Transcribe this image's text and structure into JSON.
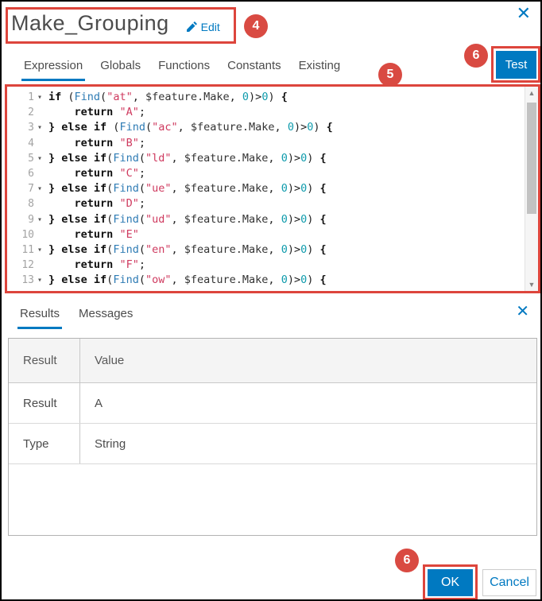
{
  "colors": {
    "accent_blue": "#0079c1",
    "annotation_red": "#dd453c",
    "badge_red": "#d94a42"
  },
  "icons": {
    "close": "✕",
    "scroll_up": "▲",
    "scroll_down": "▼",
    "fold": "▾"
  },
  "header": {
    "title": "Make_Grouping",
    "edit_label": "Edit"
  },
  "annotations": {
    "badge_title": "4",
    "badge_tabs": "5",
    "badge_test": "6",
    "badge_ok": "6"
  },
  "tabs": {
    "items": [
      "Expression",
      "Globals",
      "Functions",
      "Constants",
      "Existing"
    ],
    "active": "Expression"
  },
  "toolbar": {
    "test_label": "Test"
  },
  "editor": {
    "lines": [
      {
        "n": "1",
        "fold": true,
        "t": [
          [
            "kw",
            "if "
          ],
          [
            "pl",
            "("
          ],
          [
            "fn",
            "Find"
          ],
          [
            "pl",
            "("
          ],
          [
            "str",
            "\"at\""
          ],
          [
            "pl",
            ", "
          ],
          [
            "var",
            "$feature.Make"
          ],
          [
            "pl",
            ", "
          ],
          [
            "num",
            "0"
          ],
          [
            "pl",
            ")>"
          ],
          [
            "num",
            "0"
          ],
          [
            "pl",
            ") "
          ],
          [
            "br",
            "{"
          ]
        ]
      },
      {
        "n": "2",
        "fold": false,
        "t": [
          [
            "pl",
            "    "
          ],
          [
            "kw",
            "return"
          ],
          [
            "pl",
            " "
          ],
          [
            "str",
            "\"A\""
          ],
          [
            "pl",
            ";"
          ]
        ]
      },
      {
        "n": "3",
        "fold": true,
        "t": [
          [
            "br",
            "} "
          ],
          [
            "kw",
            "else if"
          ],
          [
            "pl",
            " ("
          ],
          [
            "fn",
            "Find"
          ],
          [
            "pl",
            "("
          ],
          [
            "str",
            "\"ac\""
          ],
          [
            "pl",
            ", "
          ],
          [
            "var",
            "$feature.Make"
          ],
          [
            "pl",
            ", "
          ],
          [
            "num",
            "0"
          ],
          [
            "pl",
            ")>"
          ],
          [
            "num",
            "0"
          ],
          [
            "pl",
            ") "
          ],
          [
            "br",
            "{"
          ]
        ]
      },
      {
        "n": "4",
        "fold": false,
        "t": [
          [
            "pl",
            "    "
          ],
          [
            "kw",
            "return"
          ],
          [
            "pl",
            " "
          ],
          [
            "str",
            "\"B\""
          ],
          [
            "pl",
            ";"
          ]
        ]
      },
      {
        "n": "5",
        "fold": true,
        "t": [
          [
            "br",
            "} "
          ],
          [
            "kw",
            "else if"
          ],
          [
            "pl",
            "("
          ],
          [
            "fn",
            "Find"
          ],
          [
            "pl",
            "("
          ],
          [
            "str",
            "\"ld\""
          ],
          [
            "pl",
            ", "
          ],
          [
            "var",
            "$feature.Make"
          ],
          [
            "pl",
            ", "
          ],
          [
            "num",
            "0"
          ],
          [
            "pl",
            ")>"
          ],
          [
            "num",
            "0"
          ],
          [
            "pl",
            ") "
          ],
          [
            "br",
            "{"
          ]
        ]
      },
      {
        "n": "6",
        "fold": false,
        "t": [
          [
            "pl",
            "    "
          ],
          [
            "kw",
            "return"
          ],
          [
            "pl",
            " "
          ],
          [
            "str",
            "\"C\""
          ],
          [
            "pl",
            ";"
          ]
        ]
      },
      {
        "n": "7",
        "fold": true,
        "t": [
          [
            "br",
            "} "
          ],
          [
            "kw",
            "else if"
          ],
          [
            "pl",
            "("
          ],
          [
            "fn",
            "Find"
          ],
          [
            "pl",
            "("
          ],
          [
            "str",
            "\"ue\""
          ],
          [
            "pl",
            ", "
          ],
          [
            "var",
            "$feature.Make"
          ],
          [
            "pl",
            ", "
          ],
          [
            "num",
            "0"
          ],
          [
            "pl",
            ")>"
          ],
          [
            "num",
            "0"
          ],
          [
            "pl",
            ") "
          ],
          [
            "br",
            "{"
          ]
        ]
      },
      {
        "n": "8",
        "fold": false,
        "t": [
          [
            "pl",
            "    "
          ],
          [
            "kw",
            "return"
          ],
          [
            "pl",
            " "
          ],
          [
            "str",
            "\"D\""
          ],
          [
            "pl",
            ";"
          ]
        ]
      },
      {
        "n": "9",
        "fold": true,
        "t": [
          [
            "br",
            "} "
          ],
          [
            "kw",
            "else if"
          ],
          [
            "pl",
            "("
          ],
          [
            "fn",
            "Find"
          ],
          [
            "pl",
            "("
          ],
          [
            "str",
            "\"ud\""
          ],
          [
            "pl",
            ", "
          ],
          [
            "var",
            "$feature.Make"
          ],
          [
            "pl",
            ", "
          ],
          [
            "num",
            "0"
          ],
          [
            "pl",
            ")>"
          ],
          [
            "num",
            "0"
          ],
          [
            "pl",
            ") "
          ],
          [
            "br",
            "{"
          ]
        ]
      },
      {
        "n": "10",
        "fold": false,
        "t": [
          [
            "pl",
            "    "
          ],
          [
            "kw",
            "return"
          ],
          [
            "pl",
            " "
          ],
          [
            "str",
            "\"E\""
          ]
        ]
      },
      {
        "n": "11",
        "fold": true,
        "t": [
          [
            "br",
            "} "
          ],
          [
            "kw",
            "else if"
          ],
          [
            "pl",
            "("
          ],
          [
            "fn",
            "Find"
          ],
          [
            "pl",
            "("
          ],
          [
            "str",
            "\"en\""
          ],
          [
            "pl",
            ", "
          ],
          [
            "var",
            "$feature.Make"
          ],
          [
            "pl",
            ", "
          ],
          [
            "num",
            "0"
          ],
          [
            "pl",
            ")>"
          ],
          [
            "num",
            "0"
          ],
          [
            "pl",
            ") "
          ],
          [
            "br",
            "{"
          ]
        ]
      },
      {
        "n": "12",
        "fold": false,
        "t": [
          [
            "pl",
            "    "
          ],
          [
            "kw",
            "return"
          ],
          [
            "pl",
            " "
          ],
          [
            "str",
            "\"F\""
          ],
          [
            "pl",
            ";"
          ]
        ]
      },
      {
        "n": "13",
        "fold": true,
        "t": [
          [
            "br",
            "} "
          ],
          [
            "kw",
            "else if"
          ],
          [
            "pl",
            "("
          ],
          [
            "fn",
            "Find"
          ],
          [
            "pl",
            "("
          ],
          [
            "str",
            "\"ow\""
          ],
          [
            "pl",
            ", "
          ],
          [
            "var",
            "$feature.Make"
          ],
          [
            "pl",
            ", "
          ],
          [
            "num",
            "0"
          ],
          [
            "pl",
            ")>"
          ],
          [
            "num",
            "0"
          ],
          [
            "pl",
            ") "
          ],
          [
            "br",
            "{"
          ]
        ]
      }
    ]
  },
  "results_panel": {
    "tabs": [
      "Results",
      "Messages"
    ],
    "active": "Results",
    "table": {
      "headers": [
        "Result",
        "Value"
      ],
      "rows": [
        [
          "Result",
          "A"
        ],
        [
          "Type",
          "String"
        ]
      ]
    }
  },
  "footer": {
    "ok_label": "OK",
    "cancel_label": "Cancel"
  }
}
